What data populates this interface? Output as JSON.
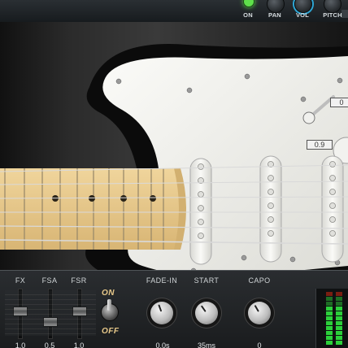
{
  "top_bar": {
    "labels": {
      "on": "ON",
      "pan": "PAN",
      "vol": "VOL",
      "pitch": "PITCH"
    },
    "on_led_color": "#5fe04b",
    "vol_accent_color": "#2ea7d6"
  },
  "guitar": {
    "value_top": "0",
    "value_mid": "0.9",
    "pickguard_color": "#eeeeea",
    "neck_color": "#e7c889",
    "body_burst_color": "#c97d2c"
  },
  "bottom_panel": {
    "sliders": [
      {
        "label": "FX",
        "value": "1.0"
      },
      {
        "label": "FSA",
        "value": "0.5"
      },
      {
        "label": "FSR",
        "value": "1.0"
      }
    ],
    "switch": {
      "on_label": "ON",
      "off_label": "OFF"
    },
    "knobs": [
      {
        "label": "FADE-IN",
        "value": "0.0s"
      },
      {
        "label": "START",
        "value": "35ms"
      },
      {
        "label": "CAPO",
        "value": "0"
      }
    ],
    "meter_colors": {
      "low": "#2bd03a",
      "high": "#e04a2b"
    }
  }
}
